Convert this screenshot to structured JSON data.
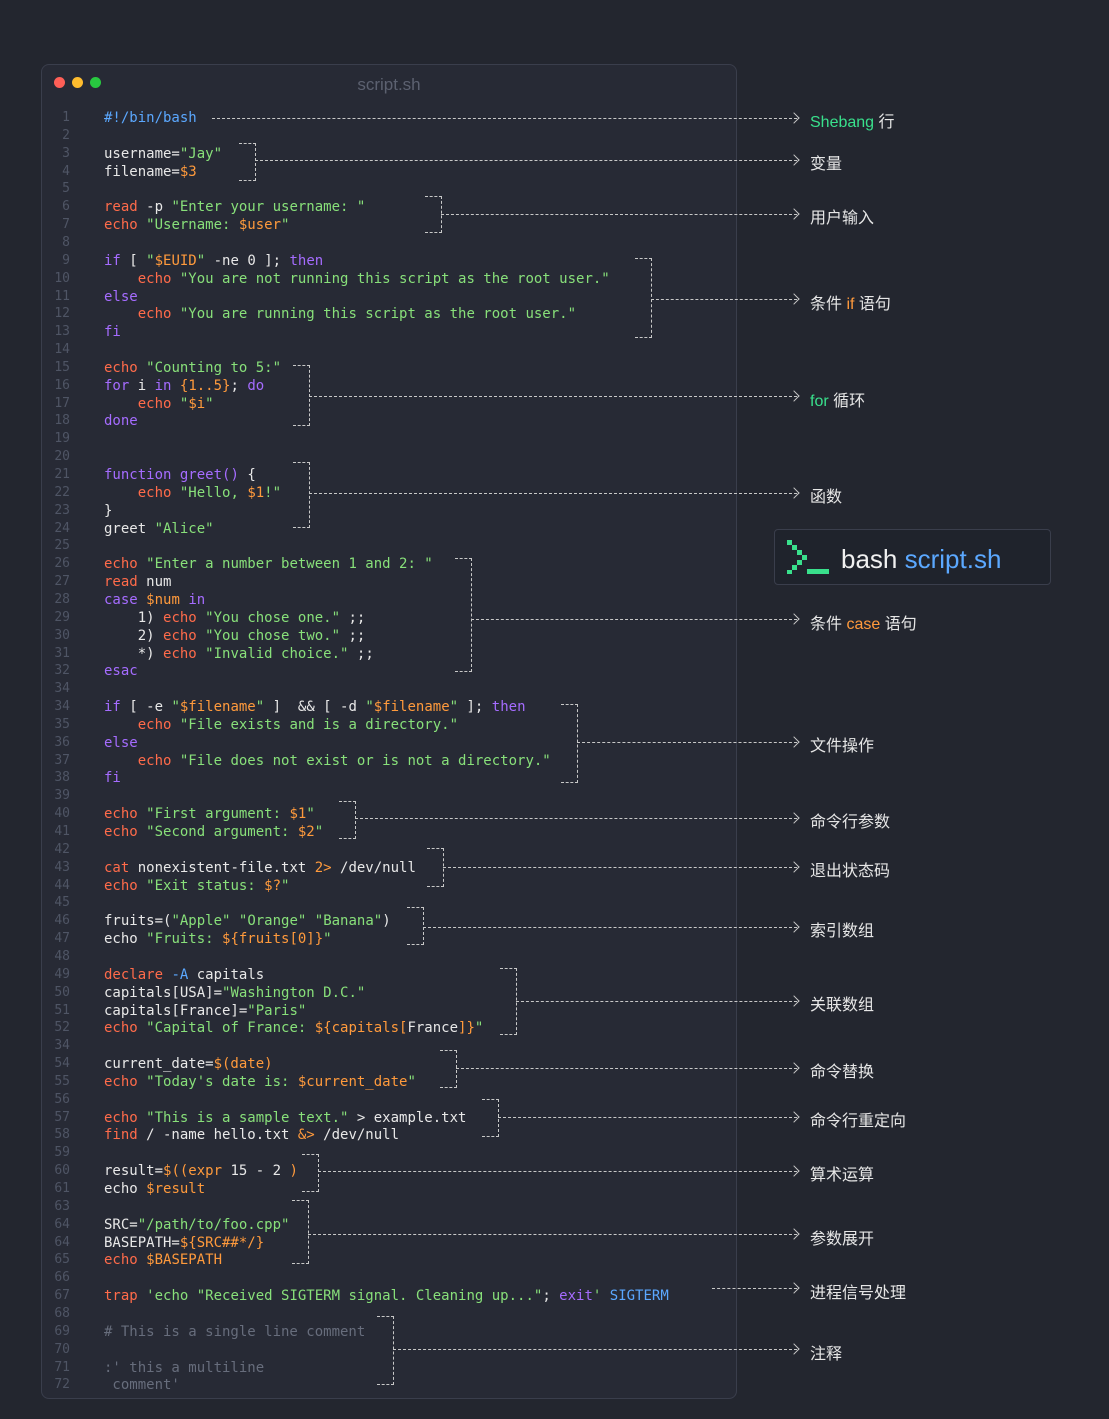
{
  "window": {
    "title": "script.sh",
    "traffic_lights": [
      "#ff5f57",
      "#febc2e",
      "#28c840"
    ]
  },
  "line_numbers": [
    "1",
    "2",
    "3",
    "4",
    "5",
    "6",
    "7",
    "8",
    "9",
    "10",
    "11",
    "12",
    "13",
    "14",
    "15",
    "16",
    "17",
    "18",
    "19",
    "20",
    "21",
    "22",
    "23",
    "24",
    "25",
    "26",
    "27",
    "28",
    "29",
    "30",
    "31",
    "32",
    "34",
    "34",
    "35",
    "36",
    "37",
    "38",
    "39",
    "40",
    "41",
    "42",
    "43",
    "44",
    "45",
    "46",
    "47",
    "48",
    "49",
    "50",
    "51",
    "52",
    "34",
    "54",
    "55",
    "56",
    "57",
    "58",
    "59",
    "60",
    "61",
    "63",
    "64",
    "64",
    "65",
    "66",
    "67",
    "68",
    "69",
    "70",
    "71",
    "72"
  ],
  "code_lines": [
    [
      [
        "c",
        "#!/bin/bash"
      ]
    ],
    [],
    [
      [
        "p",
        "username="
      ],
      [
        "s",
        "\"Jay\""
      ]
    ],
    [
      [
        "p",
        "filename="
      ],
      [
        "v",
        "$3"
      ]
    ],
    [],
    [
      [
        "m",
        "read"
      ],
      [
        "p",
        " -p "
      ],
      [
        "s",
        "\"Enter your username: \""
      ]
    ],
    [
      [
        "m",
        "echo"
      ],
      [
        "p",
        " "
      ],
      [
        "s",
        "\"Username: "
      ],
      [
        "v",
        "$user"
      ],
      [
        "s",
        "\""
      ]
    ],
    [],
    [
      [
        "k",
        "if"
      ],
      [
        "p",
        " [ "
      ],
      [
        "s",
        "\""
      ],
      [
        "v",
        "$EUID"
      ],
      [
        "s",
        "\""
      ],
      [
        "p",
        " -ne 0 ]; "
      ],
      [
        "k",
        "then"
      ]
    ],
    [
      [
        "p",
        "    "
      ],
      [
        "m",
        "echo"
      ],
      [
        "p",
        " "
      ],
      [
        "s",
        "\"You are not running this script as the root user.\""
      ]
    ],
    [
      [
        "k",
        "else"
      ]
    ],
    [
      [
        "p",
        "    "
      ],
      [
        "m",
        "echo"
      ],
      [
        "p",
        " "
      ],
      [
        "s",
        "\"You are running this script as the root user.\""
      ]
    ],
    [
      [
        "k",
        "fi"
      ]
    ],
    [],
    [
      [
        "m",
        "echo"
      ],
      [
        "p",
        " "
      ],
      [
        "s",
        "\"Counting to 5:\""
      ]
    ],
    [
      [
        "k",
        "for"
      ],
      [
        "p",
        " i "
      ],
      [
        "k",
        "in"
      ],
      [
        "p",
        " "
      ],
      [
        "v",
        "{1..5}"
      ],
      [
        "p",
        "; "
      ],
      [
        "k",
        "do"
      ]
    ],
    [
      [
        "p",
        "    "
      ],
      [
        "m",
        "echo"
      ],
      [
        "p",
        " "
      ],
      [
        "s",
        "\""
      ],
      [
        "v",
        "$i"
      ],
      [
        "s",
        "\""
      ]
    ],
    [
      [
        "k",
        "done"
      ]
    ],
    [],
    [],
    [
      [
        "k",
        "function"
      ],
      [
        "p",
        " "
      ],
      [
        "f",
        "greet()"
      ],
      [
        "p",
        " {"
      ]
    ],
    [
      [
        "p",
        "    "
      ],
      [
        "m",
        "echo"
      ],
      [
        "p",
        " "
      ],
      [
        "s",
        "\"Hello, "
      ],
      [
        "v",
        "$1"
      ],
      [
        "s",
        "!\""
      ]
    ],
    [
      [
        "p",
        "}"
      ]
    ],
    [
      [
        "p",
        "greet "
      ],
      [
        "s",
        "\"Alice\""
      ]
    ],
    [],
    [
      [
        "m",
        "echo"
      ],
      [
        "p",
        " "
      ],
      [
        "s",
        "\"Enter a number between 1 and 2: \""
      ]
    ],
    [
      [
        "m",
        "read"
      ],
      [
        "p",
        " num"
      ]
    ],
    [
      [
        "k",
        "case"
      ],
      [
        "p",
        " "
      ],
      [
        "v",
        "$num"
      ],
      [
        "p",
        " "
      ],
      [
        "k",
        "in"
      ]
    ],
    [
      [
        "p",
        "    1) "
      ],
      [
        "m",
        "echo"
      ],
      [
        "p",
        " "
      ],
      [
        "s",
        "\"You chose one.\""
      ],
      [
        "p",
        " ;;"
      ]
    ],
    [
      [
        "p",
        "    2) "
      ],
      [
        "m",
        "echo"
      ],
      [
        "p",
        " "
      ],
      [
        "s",
        "\"You chose two.\""
      ],
      [
        "p",
        " ;;"
      ]
    ],
    [
      [
        "p",
        "    *) "
      ],
      [
        "m",
        "echo"
      ],
      [
        "p",
        " "
      ],
      [
        "s",
        "\"Invalid choice.\""
      ],
      [
        "p",
        " ;;"
      ]
    ],
    [
      [
        "k",
        "esac"
      ]
    ],
    [],
    [
      [
        "k",
        "if"
      ],
      [
        "p",
        " [ -e "
      ],
      [
        "s",
        "\""
      ],
      [
        "v",
        "$filename"
      ],
      [
        "s",
        "\""
      ],
      [
        "p",
        " ]  && [ -d "
      ],
      [
        "s",
        "\""
      ],
      [
        "v",
        "$filename"
      ],
      [
        "s",
        "\""
      ],
      [
        "p",
        " ]; "
      ],
      [
        "k",
        "then"
      ]
    ],
    [
      [
        "p",
        "    "
      ],
      [
        "m",
        "echo"
      ],
      [
        "p",
        " "
      ],
      [
        "s",
        "\"File exists and is a directory.\""
      ]
    ],
    [
      [
        "k",
        "else"
      ]
    ],
    [
      [
        "p",
        "    "
      ],
      [
        "m",
        "echo"
      ],
      [
        "p",
        " "
      ],
      [
        "s",
        "\"File does not exist or is not a directory.\""
      ]
    ],
    [
      [
        "k",
        "fi"
      ]
    ],
    [],
    [
      [
        "m",
        "echo"
      ],
      [
        "p",
        " "
      ],
      [
        "s",
        "\"First argument: "
      ],
      [
        "v",
        "$1"
      ],
      [
        "s",
        "\""
      ]
    ],
    [
      [
        "m",
        "echo"
      ],
      [
        "p",
        " "
      ],
      [
        "s",
        "\"Second argument: "
      ],
      [
        "v",
        "$2"
      ],
      [
        "s",
        "\""
      ]
    ],
    [],
    [
      [
        "m",
        "cat"
      ],
      [
        "p",
        " nonexistent-file.txt "
      ],
      [
        "v",
        "2>"
      ],
      [
        "p",
        " /dev/null"
      ]
    ],
    [
      [
        "m",
        "echo"
      ],
      [
        "p",
        " "
      ],
      [
        "s",
        "\"Exit status: "
      ],
      [
        "v",
        "$?"
      ],
      [
        "s",
        "\""
      ]
    ],
    [],
    [
      [
        "p",
        "fruits=("
      ],
      [
        "s",
        "\"Apple\""
      ],
      [
        "p",
        " "
      ],
      [
        "s",
        "\"Orange\""
      ],
      [
        "p",
        " "
      ],
      [
        "s",
        "\"Banana\""
      ],
      [
        "p",
        ")"
      ]
    ],
    [
      [
        "p",
        "echo "
      ],
      [
        "s",
        "\"Fruits: "
      ],
      [
        "v",
        "${fruits[0]}"
      ],
      [
        "s",
        "\""
      ]
    ],
    [],
    [
      [
        "m",
        "declare"
      ],
      [
        "p",
        " "
      ],
      [
        "b",
        "-A"
      ],
      [
        "p",
        " capitals"
      ]
    ],
    [
      [
        "p",
        "capitals[USA]="
      ],
      [
        "s",
        "\"Washington D.C.\""
      ]
    ],
    [
      [
        "p",
        "capitals[France]="
      ],
      [
        "s",
        "\"Paris\""
      ]
    ],
    [
      [
        "m",
        "echo"
      ],
      [
        "p",
        " "
      ],
      [
        "s",
        "\"Capital of France: "
      ],
      [
        "v",
        "${capitals["
      ],
      [
        "p",
        "France"
      ],
      [
        "v",
        "]}"
      ],
      [
        "s",
        "\""
      ]
    ],
    [],
    [
      [
        "p",
        "current_date="
      ],
      [
        "v",
        "$(date)"
      ]
    ],
    [
      [
        "m",
        "echo"
      ],
      [
        "p",
        " "
      ],
      [
        "s",
        "\"Today's date is: "
      ],
      [
        "v",
        "$current_date"
      ],
      [
        "s",
        "\""
      ]
    ],
    [],
    [
      [
        "m",
        "echo"
      ],
      [
        "p",
        " "
      ],
      [
        "s",
        "\"This is a sample text.\""
      ],
      [
        "p",
        " > example.txt"
      ]
    ],
    [
      [
        "m",
        "find"
      ],
      [
        "p",
        " / -name hello.txt "
      ],
      [
        "v",
        "&>"
      ],
      [
        "p",
        " /dev/null"
      ]
    ],
    [],
    [
      [
        "p",
        "result="
      ],
      [
        "v",
        "$((expr"
      ],
      [
        "p",
        " 15 - 2 "
      ],
      [
        "v",
        ")"
      ]
    ],
    [
      [
        "p",
        "echo "
      ],
      [
        "v",
        "$result"
      ]
    ],
    [],
    [
      [
        "p",
        "SRC="
      ],
      [
        "s",
        "\"/path/to/foo.cpp\""
      ]
    ],
    [
      [
        "p",
        "BASEPATH="
      ],
      [
        "v",
        "${SRC##*/}"
      ]
    ],
    [
      [
        "m",
        "echo"
      ],
      [
        "p",
        " "
      ],
      [
        "v",
        "$BASEPATH"
      ]
    ],
    [],
    [
      [
        "m",
        "trap"
      ],
      [
        "p",
        " "
      ],
      [
        "s",
        "'echo \"Received SIGTERM signal. Cleaning up...\""
      ],
      [
        "p",
        "; "
      ],
      [
        "k",
        "exit"
      ],
      [
        "s",
        "'"
      ],
      [
        "p",
        " "
      ],
      [
        "b",
        "SIGTERM"
      ]
    ],
    [],
    [
      [
        "x",
        "# This is a single line comment"
      ]
    ],
    [],
    [
      [
        "x",
        ":' this a multiline"
      ]
    ],
    [
      [
        "x",
        " comment'"
      ]
    ]
  ],
  "annotations": [
    {
      "parts": [
        {
          "t": "Shebang",
          "c": "green"
        },
        {
          "t": " 行",
          "c": ""
        }
      ]
    },
    {
      "parts": [
        {
          "t": "变量",
          "c": ""
        }
      ]
    },
    {
      "parts": [
        {
          "t": "用户输入",
          "c": ""
        }
      ]
    },
    {
      "parts": [
        {
          "t": "条件 ",
          "c": ""
        },
        {
          "t": "if",
          "c": "orange"
        },
        {
          "t": " 语句",
          "c": ""
        }
      ]
    },
    {
      "parts": [
        {
          "t": "for",
          "c": "green"
        },
        {
          "t": " 循环",
          "c": ""
        }
      ]
    },
    {
      "parts": [
        {
          "t": "函数",
          "c": ""
        }
      ]
    },
    {
      "parts": [
        {
          "t": "条件 ",
          "c": ""
        },
        {
          "t": "case",
          "c": "orange"
        },
        {
          "t": " 语句",
          "c": ""
        }
      ]
    },
    {
      "parts": [
        {
          "t": "文件操作",
          "c": ""
        }
      ]
    },
    {
      "parts": [
        {
          "t": "命令行参数",
          "c": ""
        }
      ]
    },
    {
      "parts": [
        {
          "t": "退出状态码",
          "c": ""
        }
      ]
    },
    {
      "parts": [
        {
          "t": "索引数组",
          "c": ""
        }
      ]
    },
    {
      "parts": [
        {
          "t": "关联数组",
          "c": ""
        }
      ]
    },
    {
      "parts": [
        {
          "t": "命令替换",
          "c": ""
        }
      ]
    },
    {
      "parts": [
        {
          "t": "命令行重定向",
          "c": ""
        }
      ]
    },
    {
      "parts": [
        {
          "t": "算术运算",
          "c": ""
        }
      ]
    },
    {
      "parts": [
        {
          "t": "参数展开",
          "c": ""
        }
      ]
    },
    {
      "parts": [
        {
          "t": "进程信号处理",
          "c": ""
        }
      ]
    },
    {
      "parts": [
        {
          "t": "注释",
          "c": ""
        }
      ]
    }
  ],
  "badge": {
    "command": "bash",
    "argument": "script.sh",
    "icon": "terminal-prompt-icon"
  },
  "colors": {
    "background": "#23262f",
    "keyword": "#a56cff",
    "command": "#ff6b4a",
    "string": "#88e07a",
    "variable": "#ff9a3c",
    "accent_green": "#39e08c",
    "accent_blue": "#5ba8ff"
  }
}
